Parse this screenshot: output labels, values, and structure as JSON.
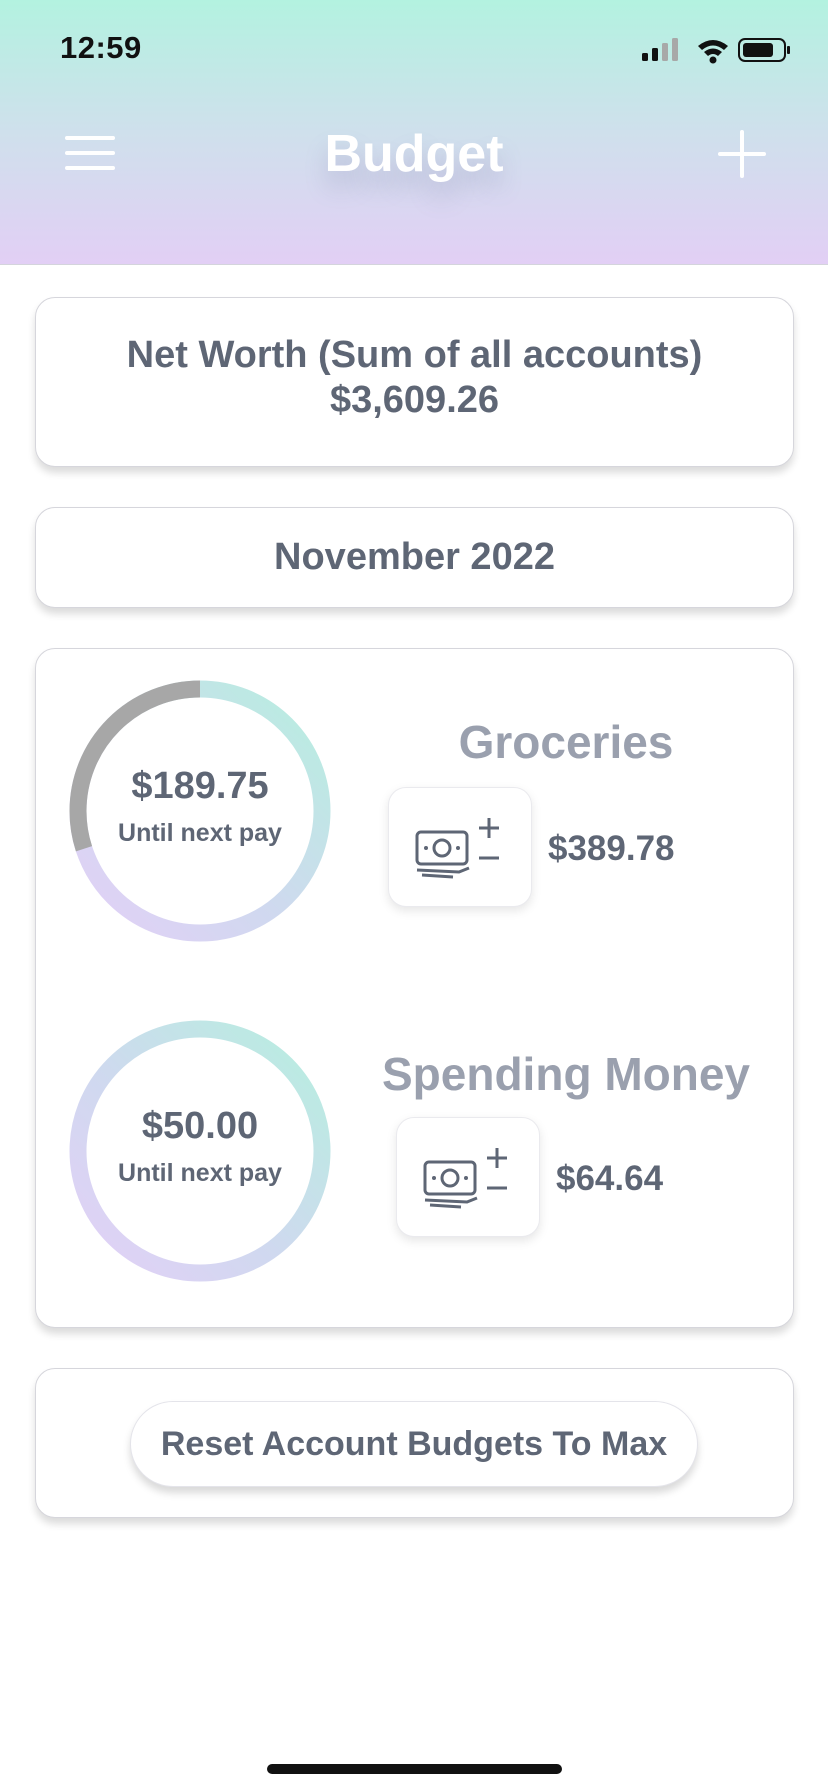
{
  "status_bar": {
    "time": "12:59"
  },
  "header": {
    "title": "Budget"
  },
  "net_worth": {
    "label": "Net Worth (Sum of all accounts)",
    "value": "$3,609.26"
  },
  "period": {
    "label": "November 2022"
  },
  "accounts": [
    {
      "name": "Groceries",
      "remaining": "$189.75",
      "caption": "Until next pay",
      "balance": "$389.78",
      "spent_fraction": 0.3
    },
    {
      "name": "Spending Money",
      "remaining": "$50.00",
      "caption": "Until next pay",
      "balance": "$64.64",
      "spent_fraction": 0
    }
  ],
  "actions": {
    "reset_label": "Reset Account Budgets To Max"
  },
  "colors": {
    "ring_start": "#b6efdf",
    "ring_mid": "#cfd9ef",
    "ring_end": "#e3d0f7",
    "ring_spent": "#a7a7a7",
    "text": "#5e6675",
    "account_name": "#9aa0ae"
  },
  "icons": {
    "menu": "hamburger-menu-icon",
    "add": "plus-icon",
    "money_adjust": "cash-plus-minus-icon"
  }
}
